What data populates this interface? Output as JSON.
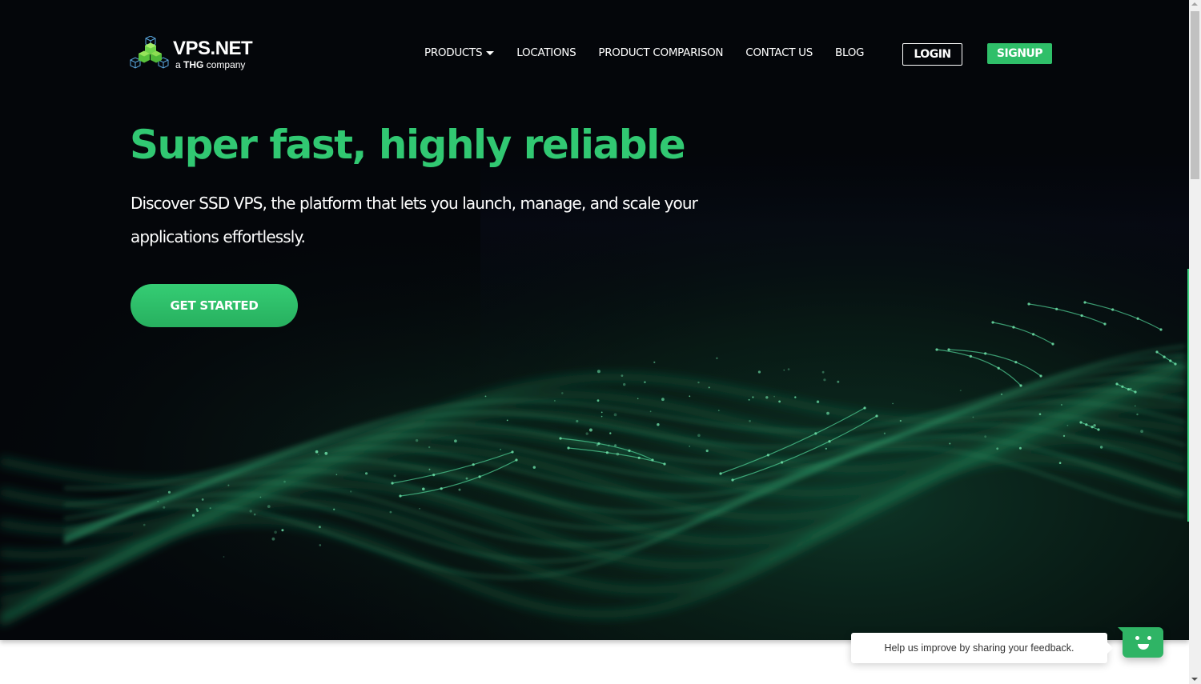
{
  "brand": {
    "name": "VPS.NET",
    "tagline_prefix": "a",
    "tagline_company": "THG",
    "tagline_suffix": "company",
    "logo_icon": "stacked-cubes-icon"
  },
  "nav": {
    "items": [
      {
        "label": "PRODUCTS",
        "has_dropdown": true
      },
      {
        "label": "LOCATIONS"
      },
      {
        "label": "PRODUCT COMPARISON"
      },
      {
        "label": "CONTACT US"
      },
      {
        "label": "BLOG"
      }
    ],
    "login_label": "LOGIN",
    "signup_label": "SIGNUP"
  },
  "hero": {
    "headline": "Super fast, highly reliable",
    "subheadline": "Discover SSD VPS, the platform that lets you launch, manage, and scale your applications effortlessly.",
    "cta_label": "GET STARTED"
  },
  "feedback": {
    "prompt": "Help us improve by sharing your feedback.",
    "icon": "smiley-chat-icon"
  },
  "colors": {
    "accent_green": "#31c872",
    "button_green": "#2fbf69",
    "background": "#04060a",
    "text": "#ffffff"
  }
}
